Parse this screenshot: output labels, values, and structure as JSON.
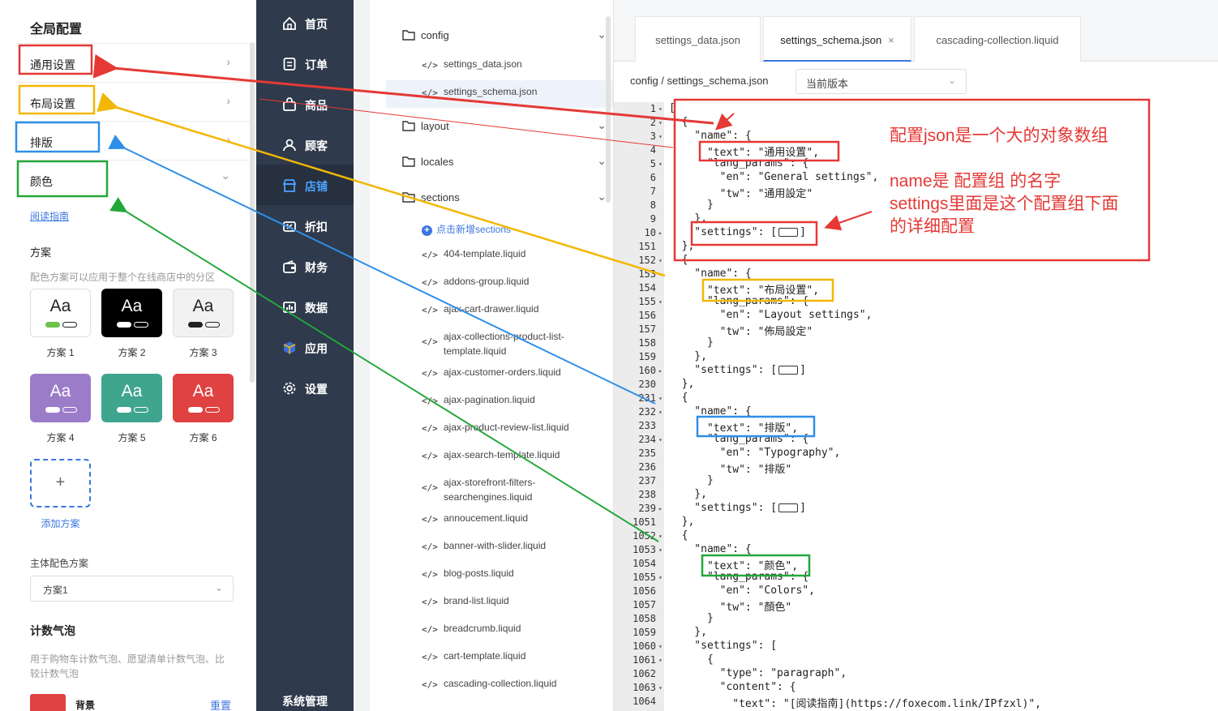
{
  "left_panel": {
    "title": "全局配置",
    "items": [
      {
        "label": "通用设置",
        "chevron": "›"
      },
      {
        "label": "布局设置",
        "chevron": "›"
      },
      {
        "label": "排版",
        "chevron": "›"
      },
      {
        "label": "颜色",
        "chevron": "⌄"
      }
    ],
    "guide_link": "阅读指南",
    "scheme_heading": "方案",
    "scheme_desc": "配色方案可以应用于整个在线商店中的分区",
    "schemes": [
      {
        "label": "方案 1",
        "aa": "Aa",
        "bg": "#ffffff",
        "fg": "#222222",
        "pill": "#6cc24a"
      },
      {
        "label": "方案 2",
        "aa": "Aa",
        "bg": "#000000",
        "fg": "#ffffff",
        "pill": "#ffffff"
      },
      {
        "label": "方案 3",
        "aa": "Aa",
        "bg": "#f2f2f2",
        "fg": "#222222",
        "pill": "#222222"
      },
      {
        "label": "方案 4",
        "aa": "Aa",
        "bg": "#9b7cc9",
        "fg": "#ffffff",
        "pill": "#ffffff"
      },
      {
        "label": "方案 5",
        "aa": "Aa",
        "bg": "#3fa58f",
        "fg": "#ffffff",
        "pill": "#ffffff"
      },
      {
        "label": "方案 6",
        "aa": "Aa",
        "bg": "#e04141",
        "fg": "#ffffff",
        "pill": "#ffffff"
      }
    ],
    "add_scheme": "添加方案",
    "add_icon": "+",
    "main_scheme_label": "主体配色方案",
    "main_scheme_value": "方案1",
    "bubble_heading": "计数气泡",
    "bubble_desc_1": "用于购物车计数气泡、愿望清单计数气泡、比",
    "bubble_desc_2": "较计数气泡",
    "bg_label": "背景",
    "reset_label": "重置"
  },
  "nav": {
    "items": [
      {
        "label": "首页",
        "icon": "home-icon"
      },
      {
        "label": "订单",
        "icon": "order-icon"
      },
      {
        "label": "商品",
        "icon": "bag-icon"
      },
      {
        "label": "顾客",
        "icon": "user-icon"
      },
      {
        "label": "店铺",
        "icon": "store-icon"
      },
      {
        "label": "折扣",
        "icon": "discount-icon"
      },
      {
        "label": "财务",
        "icon": "wallet-icon"
      },
      {
        "label": "数据",
        "icon": "chart-icon"
      },
      {
        "label": "应用",
        "icon": "box-icon"
      },
      {
        "label": "设置",
        "icon": "gear-icon"
      }
    ],
    "active": "店铺",
    "system": "系统管理"
  },
  "tree": {
    "folders": [
      {
        "label": "config",
        "chevron": "⌄"
      },
      {
        "label": "layout",
        "chevron": "⌄"
      },
      {
        "label": "locales",
        "chevron": "⌄"
      },
      {
        "label": "sections",
        "chevron": "⌄"
      }
    ],
    "config_files": [
      "settings_data.json",
      "settings_schema.json"
    ],
    "add_sections": "点击新增sections",
    "section_files": [
      "404-template.liquid",
      "addons-group.liquid",
      "ajax-cart-drawer.liquid",
      "ajax-collections-product-list-template.liquid",
      "ajax-customer-orders.liquid",
      "ajax-pagination.liquid",
      "ajax-product-review-list.liquid",
      "ajax-search-template.liquid",
      "ajax-storefront-filters-searchengines.liquid",
      "annoucement.liquid",
      "banner-with-slider.liquid",
      "blog-posts.liquid",
      "brand-list.liquid",
      "breadcrumb.liquid",
      "cart-template.liquid",
      "cascading-collection.liquid"
    ],
    "file_icon": "</>"
  },
  "editor": {
    "tabs": [
      {
        "label": "settings_data.json"
      },
      {
        "label": "settings_schema.json",
        "close": "×"
      },
      {
        "label": "cascading-collection.liquid"
      }
    ],
    "breadcrumb": "config / settings_schema.json",
    "version_select": "当前版本",
    "lines": [
      {
        "n": "1",
        "f": "▾",
        "t": "["
      },
      {
        "n": "2",
        "f": "▾",
        "t": "  {"
      },
      {
        "n": "3",
        "f": "▾",
        "t": "    \"name\": {"
      },
      {
        "n": "4",
        "f": "",
        "t": "      \"text\": \"通用设置\","
      },
      {
        "n": "5",
        "f": "▾",
        "t": "      \"lang_params\": {"
      },
      {
        "n": "6",
        "f": "",
        "t": "        \"en\": \"General settings\","
      },
      {
        "n": "7",
        "f": "",
        "t": "        \"tw\": \"通用設定\""
      },
      {
        "n": "8",
        "f": "",
        "t": "      }"
      },
      {
        "n": "9",
        "f": "",
        "t": "    },"
      },
      {
        "n": "10",
        "f": "▸",
        "t": "    \"settings\": [",
        "c": true
      },
      {
        "n": "151",
        "f": "",
        "t": "  },"
      },
      {
        "n": "152",
        "f": "▾",
        "t": "  {"
      },
      {
        "n": "153",
        "f": "▾",
        "t": "    \"name\": {"
      },
      {
        "n": "154",
        "f": "",
        "t": "      \"text\": \"布局设置\","
      },
      {
        "n": "155",
        "f": "▾",
        "t": "      \"lang_params\": {"
      },
      {
        "n": "156",
        "f": "",
        "t": "        \"en\": \"Layout settings\","
      },
      {
        "n": "157",
        "f": "",
        "t": "        \"tw\": \"佈局設定\""
      },
      {
        "n": "158",
        "f": "",
        "t": "      }"
      },
      {
        "n": "159",
        "f": "",
        "t": "    },"
      },
      {
        "n": "160",
        "f": "▸",
        "t": "    \"settings\": [",
        "c": true
      },
      {
        "n": "230",
        "f": "",
        "t": "  },"
      },
      {
        "n": "231",
        "f": "▾",
        "t": "  {"
      },
      {
        "n": "232",
        "f": "▾",
        "t": "    \"name\": {"
      },
      {
        "n": "233",
        "f": "",
        "t": "      \"text\": \"排版\","
      },
      {
        "n": "234",
        "f": "▾",
        "t": "      \"lang_params\": {"
      },
      {
        "n": "235",
        "f": "",
        "t": "        \"en\": \"Typography\","
      },
      {
        "n": "236",
        "f": "",
        "t": "        \"tw\": \"排版\""
      },
      {
        "n": "237",
        "f": "",
        "t": "      }"
      },
      {
        "n": "238",
        "f": "",
        "t": "    },"
      },
      {
        "n": "239",
        "f": "▸",
        "t": "    \"settings\": [",
        "c": true
      },
      {
        "n": "1051",
        "f": "",
        "t": "  },"
      },
      {
        "n": "1052",
        "f": "▾",
        "t": "  {"
      },
      {
        "n": "1053",
        "f": "▾",
        "t": "    \"name\": {"
      },
      {
        "n": "1054",
        "f": "",
        "t": "      \"text\": \"颜色\","
      },
      {
        "n": "1055",
        "f": "▾",
        "t": "      \"lang_params\": {"
      },
      {
        "n": "1056",
        "f": "",
        "t": "        \"en\": \"Colors\","
      },
      {
        "n": "1057",
        "f": "",
        "t": "        \"tw\": \"顏色\""
      },
      {
        "n": "1058",
        "f": "",
        "t": "      }"
      },
      {
        "n": "1059",
        "f": "",
        "t": "    },"
      },
      {
        "n": "1060",
        "f": "▾",
        "t": "    \"settings\": ["
      },
      {
        "n": "1061",
        "f": "▾",
        "t": "      {"
      },
      {
        "n": "1062",
        "f": "",
        "t": "        \"type\": \"paragraph\","
      },
      {
        "n": "1063",
        "f": "▾",
        "t": "        \"content\": {"
      },
      {
        "n": "1064",
        "f": "",
        "t": "          \"text\": \"[阅读指南](https://foxecom.link/IPfzxl)\","
      }
    ]
  },
  "annotations": {
    "note_1": "配置json是一个大的对象数组",
    "note_2": "name是  配置组 的名字",
    "note_3": "settings里面是这个配置组下面",
    "note_4": "的详细配置",
    "colors": {
      "red": "#e53935",
      "yellow": "#f2b705",
      "blue": "#2f8fe8",
      "green": "#22a83a"
    }
  }
}
